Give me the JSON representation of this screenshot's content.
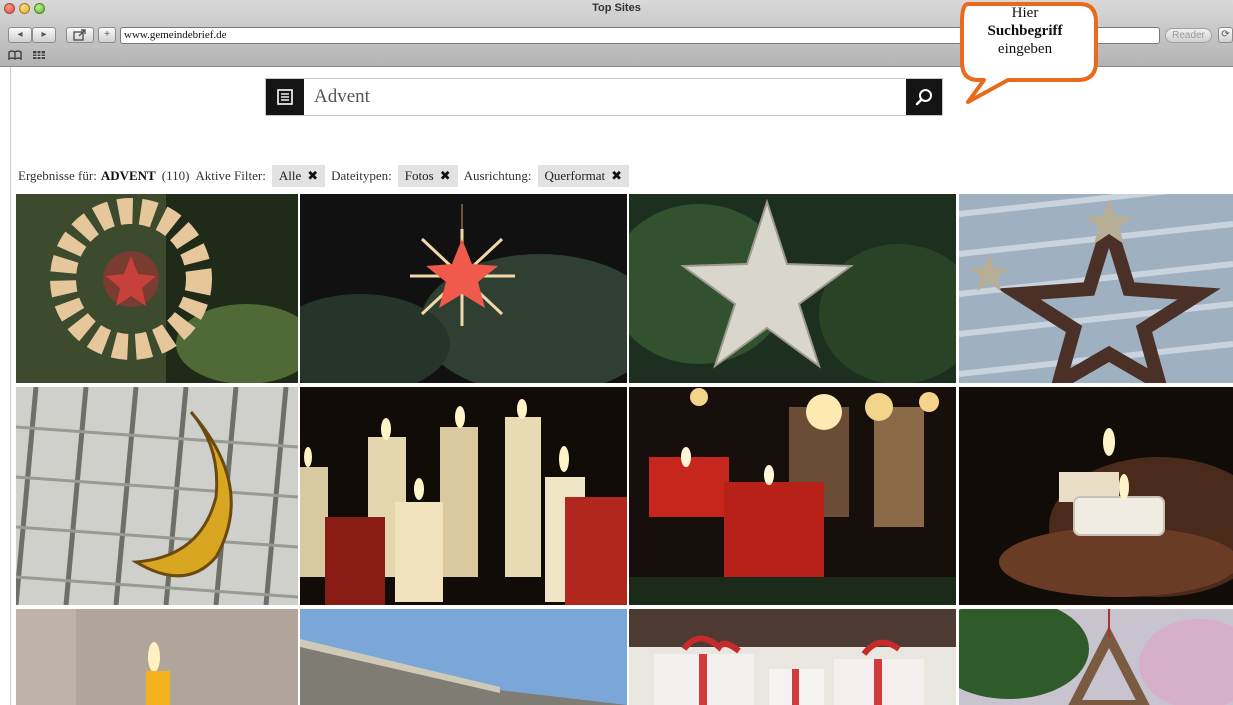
{
  "window": {
    "title": "Top Sites",
    "address": "www.gemeindebrief.de",
    "reader_label": "Reader"
  },
  "search": {
    "value": "Advent",
    "list_icon": "list-icon",
    "search_icon": "search-icon"
  },
  "callout": {
    "line1": "Hier",
    "line2": "Suchbegriff",
    "line3": "eingeben",
    "accent": "#e86a1a"
  },
  "filters": {
    "results_prefix": "Ergebnisse für:",
    "term": "ADVENT",
    "count": "(110)",
    "active_label": "Aktive Filter:",
    "chip_all": "Alle",
    "filetypes_label": "Dateitypen:",
    "chip_photos": "Fotos",
    "orientation_label": "Ausrichtung:",
    "chip_landscape": "Querformat",
    "remove_icon": "close-icon"
  },
  "grid": {
    "photos": [
      "straw-star-wreath",
      "red-straw-star-on-fir",
      "white-wooden-star",
      "star-garland-on-window",
      "crescent-moon-on-curtain",
      "burning-white-candles",
      "red-advent-candles",
      "tealight-in-hands",
      "single-candle",
      "roof-against-sky",
      "christmas-gift-boxes",
      "wooden-tree-ornament"
    ]
  }
}
